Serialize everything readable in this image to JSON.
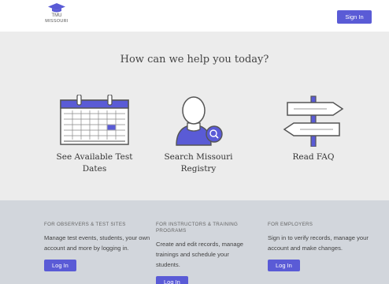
{
  "header": {
    "logo_line1": "TMU",
    "logo_line2": "MISSOURI",
    "signin_label": "Sign In"
  },
  "hero": {
    "title": "How can we help you today?"
  },
  "options": [
    {
      "label_line1": "See Available Test",
      "label_line2": "Dates",
      "icon": "calendar-icon"
    },
    {
      "label_line1": "Search Missouri",
      "label_line2": "Registry",
      "icon": "person-search-icon"
    },
    {
      "label_line1": "Read FAQ",
      "icon": "signpost-icon"
    }
  ],
  "footer": {
    "columns": [
      {
        "title": "FOR OBSERVERS & TEST SITES",
        "text": "Manage test events, students, your own account and more by logging in.",
        "button": "Log In"
      },
      {
        "title": "FOR INSTRUCTORS & TRAINING PROGRAMS",
        "text": "Create and edit records, manage trainings and schedule your students.",
        "button": "Log In"
      },
      {
        "title": "FOR EMPLOYERS",
        "text": "Sign in to verify records, manage your account and make changes.",
        "button": "Log In"
      }
    ]
  },
  "colors": {
    "accent": "#5a5bd6",
    "page_bg": "#ececec",
    "footer_bg": "#d2d6dc"
  }
}
